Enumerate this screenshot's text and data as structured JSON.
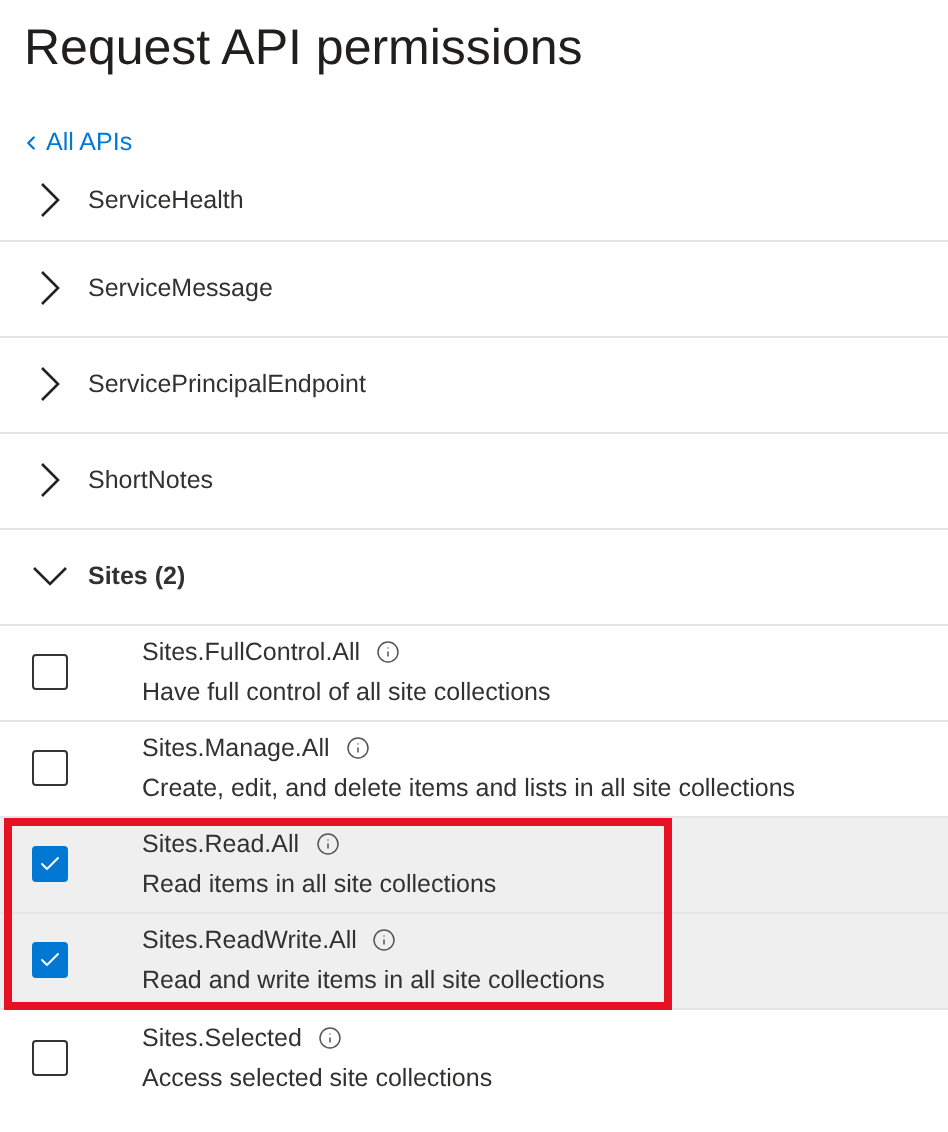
{
  "title": "Request API permissions",
  "back_link": "All APIs",
  "groups": [
    {
      "label": "ServiceHealth",
      "expanded": false
    },
    {
      "label": "ServiceMessage",
      "expanded": false
    },
    {
      "label": "ServicePrincipalEndpoint",
      "expanded": false
    },
    {
      "label": "ShortNotes",
      "expanded": false
    },
    {
      "label": "Sites (2)",
      "expanded": true,
      "permissions": [
        {
          "name": "Sites.FullControl.All",
          "description": "Have full control of all site collections",
          "checked": false,
          "highlighted": false
        },
        {
          "name": "Sites.Manage.All",
          "description": "Create, edit, and delete items and lists in all site collections",
          "checked": false,
          "highlighted": false
        },
        {
          "name": "Sites.Read.All",
          "description": "Read items in all site collections",
          "checked": true,
          "highlighted": true
        },
        {
          "name": "Sites.ReadWrite.All",
          "description": "Read and write items in all site collections",
          "checked": true,
          "highlighted": true
        },
        {
          "name": "Sites.Selected",
          "description": "Access selected site collections",
          "checked": false,
          "highlighted": false
        }
      ]
    }
  ]
}
